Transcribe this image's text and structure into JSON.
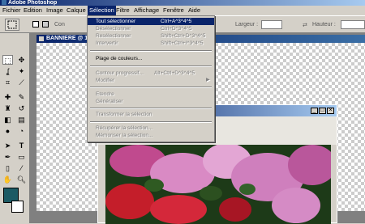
{
  "app": {
    "title": "Adobe Photoshop"
  },
  "menubar": {
    "items": [
      "Fichier",
      "Edition",
      "Image",
      "Calque",
      "Sélection",
      "Filtre",
      "Affichage",
      "Fenêtre",
      "Aide"
    ],
    "active_index": 4
  },
  "options": {
    "con_label": "Con",
    "largeur_label": "Largeur :",
    "hauteur_label": "Hauteur :"
  },
  "document": {
    "title": "BANNIERE @ 1"
  },
  "selection_menu": {
    "items": [
      {
        "label": "Tout sélectionner",
        "shortcut": "Ctrl+A^3^4^5",
        "state": "highlighted"
      },
      {
        "label": "Désélectionner",
        "shortcut": "Ctrl+D^3^4^5",
        "state": "disabled"
      },
      {
        "label": "Resélectionner",
        "shortcut": "Shift+Ctrl+D^3^4^5",
        "state": "disabled"
      },
      {
        "label": "Intervertir",
        "shortcut": "Shift+Ctrl+I^3^4^5",
        "state": "disabled"
      },
      {
        "label": "Plage de couleurs...",
        "shortcut": "",
        "state": "enabled"
      },
      {
        "label": "Contour progressif...",
        "shortcut": "Alt+Ctrl+D^3^4^5",
        "state": "disabled"
      },
      {
        "label": "Modifier",
        "shortcut": "",
        "state": "disabled",
        "submenu": true
      },
      {
        "label": "Etendre",
        "shortcut": "",
        "state": "disabled"
      },
      {
        "label": "Généraliser",
        "shortcut": "",
        "state": "disabled"
      },
      {
        "label": "Transformer la sélection",
        "shortcut": "",
        "state": "disabled"
      },
      {
        "label": "Récupérer la sélection...",
        "shortcut": "",
        "state": "disabled"
      },
      {
        "label": "Mémoriser la sélection...",
        "shortcut": "",
        "state": "disabled"
      }
    ]
  },
  "colors": {
    "foreground": "#1c5a64",
    "background": "#ffffff",
    "menu_highlight": "#0a246a"
  }
}
